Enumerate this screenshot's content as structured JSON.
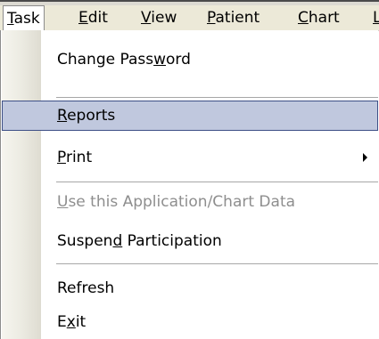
{
  "menubar": {
    "items": [
      {
        "label": "Task",
        "accel": "T",
        "rest": "ask"
      },
      {
        "label": "Edit",
        "accel": "E",
        "rest": "dit"
      },
      {
        "label": "View",
        "accel": "V",
        "rest": "iew"
      },
      {
        "label": "Patient",
        "accel": "P",
        "rest": "atient"
      },
      {
        "label": "Chart",
        "accel": "C",
        "rest": "hart"
      },
      {
        "label": "L",
        "accel": "L",
        "rest": ""
      }
    ]
  },
  "menu": {
    "items": [
      {
        "label": "Change Password",
        "pre": "Change Pass",
        "accel": "w",
        "post": "ord",
        "state": "normal"
      },
      {
        "label": "Reports",
        "pre": "",
        "accel": "R",
        "post": "eports",
        "state": "selected"
      },
      {
        "label": "Print",
        "pre": "",
        "accel": "P",
        "post": "rint",
        "state": "normal",
        "submenu_icon": "submenu-arrow-icon"
      },
      {
        "label": "Use this Application/Chart Data",
        "pre": "",
        "accel": "U",
        "post": "se this Application/Chart Data",
        "state": "disabled"
      },
      {
        "label": "Suspend Participation",
        "pre": "Suspen",
        "accel": "d",
        "post": " Participation",
        "state": "normal"
      },
      {
        "label": "Refresh",
        "pre": "Refresh",
        "accel": "",
        "post": "",
        "state": "normal"
      },
      {
        "label": "Exit",
        "pre": "E",
        "accel": "x",
        "post": "it",
        "state": "normal"
      }
    ]
  },
  "colors": {
    "menubar_bg": "#ece9d8",
    "selection_bg": "#c0c8de",
    "selection_border": "#3d4f86",
    "disabled_text": "#8e8e8e"
  }
}
